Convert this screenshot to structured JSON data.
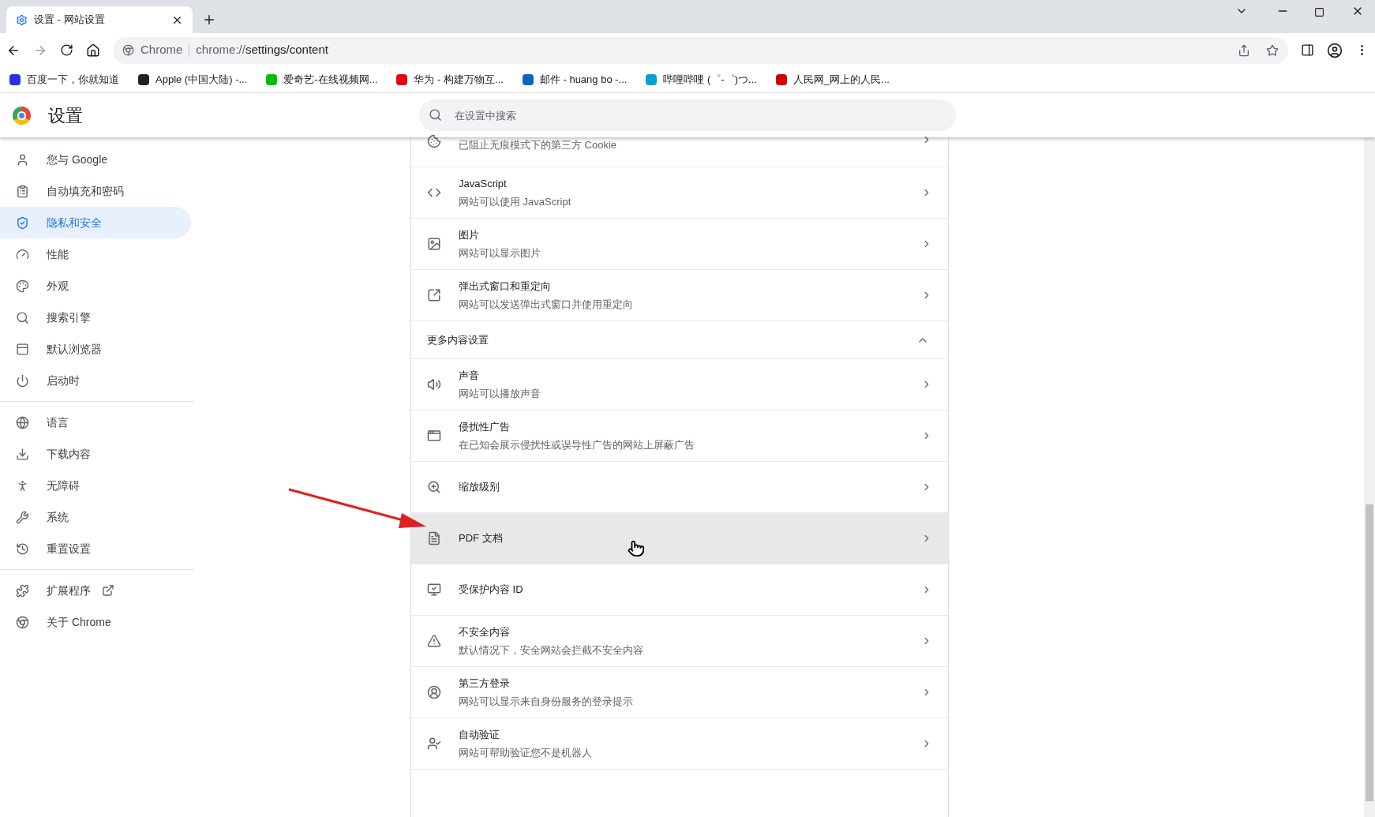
{
  "tab": {
    "title": "设置 - 网站设置",
    "selected": true
  },
  "address": {
    "site": "Chrome",
    "url_prefix": "chrome://",
    "url_path": "settings/content"
  },
  "bookmarks": [
    {
      "label": "百度一下，你就知道",
      "color": "#2932e1"
    },
    {
      "label": "Apple (中国大陆) -...",
      "color": "#222222"
    },
    {
      "label": "爱奇艺-在线视频网...",
      "color": "#00be06"
    },
    {
      "label": "华为 - 构建万物互...",
      "color": "#e60012"
    },
    {
      "label": "邮件 - huang bo -...",
      "color": "#0a64c8"
    },
    {
      "label": "哔哩哔哩 (゜-゜)つ...",
      "color": "#00a1d6"
    },
    {
      "label": "人民网_网上的人民...",
      "color": "#d40000"
    }
  ],
  "header": {
    "title": "设置",
    "search_placeholder": "在设置中搜索"
  },
  "sidebar_groups": [
    [
      {
        "label": "您与 Google",
        "selected": false
      },
      {
        "label": "自动填充和密码",
        "selected": false
      },
      {
        "label": "隐私和安全",
        "selected": true
      },
      {
        "label": "性能",
        "selected": false
      },
      {
        "label": "外观",
        "selected": false
      },
      {
        "label": "搜索引擎",
        "selected": false
      },
      {
        "label": "默认浏览器",
        "selected": false
      },
      {
        "label": "启动时",
        "selected": false
      }
    ],
    [
      {
        "label": "语言",
        "selected": false
      },
      {
        "label": "下载内容",
        "selected": false
      },
      {
        "label": "无障碍",
        "selected": false
      },
      {
        "label": "系统",
        "selected": false
      },
      {
        "label": "重置设置",
        "selected": false
      }
    ],
    [
      {
        "label": "扩展程序",
        "selected": false,
        "external": true
      },
      {
        "label": "关于 Chrome",
        "selected": false
      }
    ]
  ],
  "content": [
    {
      "kind": "row",
      "subtitle": "已阻止无痕模式下的第三方 Cookie",
      "partial": true,
      "hovered": false
    },
    {
      "kind": "row",
      "title": "JavaScript",
      "subtitle": "网站可以使用 JavaScript",
      "hovered": false
    },
    {
      "kind": "row",
      "title": "图片",
      "subtitle": "网站可以显示图片",
      "hovered": false
    },
    {
      "kind": "row",
      "title": "弹出式窗口和重定向",
      "subtitle": "网站可以发送弹出式窗口并使用重定向",
      "hovered": false
    },
    {
      "kind": "section",
      "title": "更多内容设置",
      "expanded": true
    },
    {
      "kind": "row",
      "title": "声音",
      "subtitle": "网站可以播放声音",
      "hovered": false
    },
    {
      "kind": "row",
      "title": "侵扰性广告",
      "subtitle": "在已知会展示侵扰性或误导性广告的网站上屏蔽广告",
      "hovered": false
    },
    {
      "kind": "row",
      "title": "缩放级别",
      "hovered": false
    },
    {
      "kind": "row",
      "title": "PDF 文档",
      "hovered": true
    },
    {
      "kind": "row",
      "title": "受保护内容 ID",
      "hovered": false
    },
    {
      "kind": "row",
      "title": "不安全内容",
      "subtitle": "默认情况下，安全网站会拦截不安全内容",
      "hovered": false
    },
    {
      "kind": "row",
      "title": "第三方登录",
      "subtitle": "网站可以显示来自身份服务的登录提示",
      "hovered": false
    },
    {
      "kind": "row",
      "title": "自动验证",
      "subtitle": "网站可帮助验证您不是机器人",
      "hovered": false
    }
  ]
}
